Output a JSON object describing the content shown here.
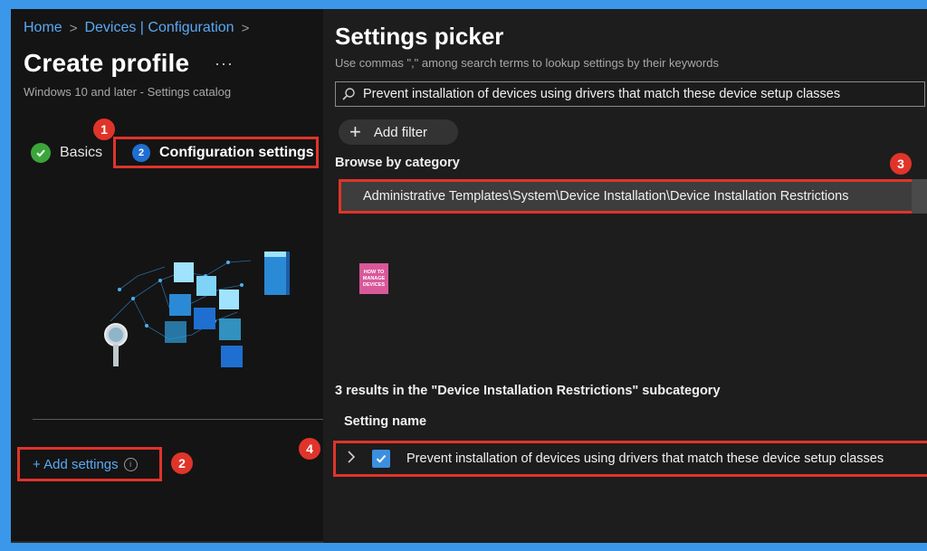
{
  "breadcrumb": {
    "home": "Home",
    "sep": ">",
    "config": "Devices | Configuration"
  },
  "header": {
    "title": "Create profile",
    "more": "···",
    "subtitle": "Windows 10 and later - Settings catalog"
  },
  "steps": {
    "basics": "Basics",
    "config_number": "2",
    "config_label": "Configuration settings"
  },
  "left": {
    "add_settings": "+ Add settings",
    "info": "i"
  },
  "callouts": {
    "one": "1",
    "two": "2",
    "three": "3",
    "four": "4"
  },
  "picker": {
    "title": "Settings picker",
    "hint": "Use commas \",\" among search terms to lookup settings by their keywords",
    "search_value": "Prevent installation of devices using drivers that match these  device setup classes",
    "add_filter": "Add filter",
    "browse_label": "Browse by category",
    "category": "Administrative Templates\\System\\Device Installation\\Device Installation Restrictions",
    "results": "3 results in the \"Device Installation Restrictions\" subcategory",
    "column_header": "Setting name",
    "setting": "Prevent installation of devices using drivers that match these device setup classes",
    "setting_checked": true
  },
  "logo": {
    "line1": "HOW TO",
    "line2": "MANAGE",
    "line3": "DEVICES"
  },
  "colors": {
    "accent": "#5aa9f2",
    "highlight": "#e0342a",
    "check_green": "#3aa63a",
    "checkbox_blue": "#3c8fe0"
  }
}
